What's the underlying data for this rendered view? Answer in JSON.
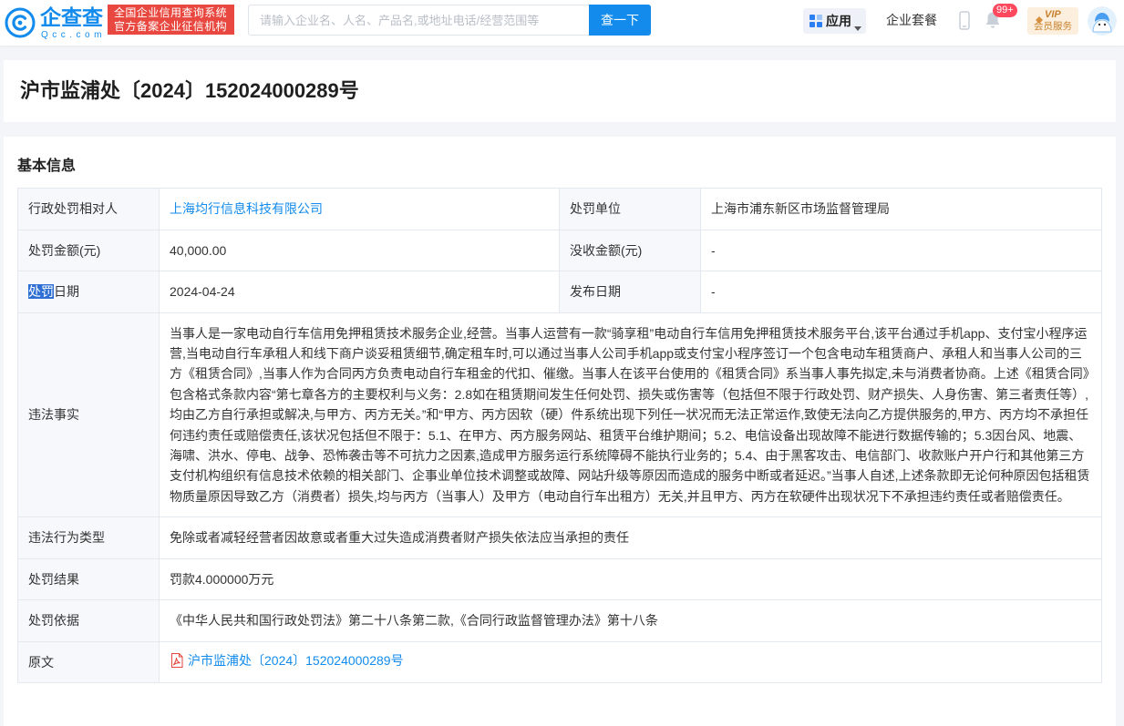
{
  "colors": {
    "brand": "#128bed",
    "link": "#128bed",
    "slogan_bg": "#e8483f",
    "badge": "#fd485e",
    "vip_text": "#c9822f",
    "vip_bg": "#fcefdd",
    "selection": "#2f6fd4",
    "page_bg": "#f3f5f8",
    "label_bg": "#f6f8fb",
    "border": "#e4e8ef"
  },
  "header": {
    "logo": {
      "name": "企查查",
      "domain": "Qcc.com",
      "icon": "qcc-logo-icon"
    },
    "slogan": [
      "全国企业信用查询系统",
      "官方备案企业征信机构"
    ],
    "search": {
      "placeholder": "请输入企业名、人名、产品名,或地址电话/经营范围等",
      "value": "",
      "button": "查一下"
    },
    "apps": {
      "label": "应用",
      "icon": "grid-icon"
    },
    "package": "企业套餐",
    "phone_icon": "mobile-phone-icon",
    "notifications": {
      "icon": "bell-icon",
      "badge": "99+"
    },
    "vip": {
      "title": "VIP",
      "subtitle": "会员服务"
    },
    "avatar_icon": "user-avatar"
  },
  "document": {
    "title": "沪市监浦处〔2024〕152024000289号"
  },
  "section": {
    "title": "基本信息"
  },
  "info": {
    "party": {
      "label": "行政处罚相对人",
      "value": "上海均行信息科技有限公司"
    },
    "authority": {
      "label": "处罚单位",
      "value": "上海市浦东新区市场监督管理局"
    },
    "fine_amount": {
      "label": "处罚金额(元)",
      "value": "40,000.00"
    },
    "confiscated_amount": {
      "label": "没收金额(元)",
      "value": "-"
    },
    "penalty_date": {
      "label_selected": "处罚",
      "label_rest": "日期",
      "value": "2024-04-24"
    },
    "publish_date": {
      "label": "发布日期",
      "value": "-"
    },
    "violation_facts": {
      "label": "违法事实",
      "value": "当事人是一家电动自行车信用免押租赁技术服务企业,经营。当事人运营有一款“骑享租”电动自行车信用免押租赁技术服务平台,该平台通过手机app、支付宝小程序运营,当电动自行车承租人和线下商户谈妥租赁细节,确定租车时,可以通过当事人公司手机app或支付宝小程序签订一个包含电动车租赁商户、承租人和当事人公司的三方《租赁合同》,当事人作为合同丙方负责电动自行车租金的代扣、催缴。当事人在该平台使用的《租赁合同》系当事人事先拟定,未与消费者协商。上述《租赁合同》包含格式条款内容“第七章各方的主要权利与义务：2.8如在租赁期间发生任何处罚、损失或伤害等（包括但不限于行政处罚、财产损失、人身伤害、第三者责任等）,均由乙方自行承担或解决,与甲方、丙方无关。”和“甲方、丙方因软（硬）件系统出现下列任一状况而无法正常运作,致使无法向乙方提供服务的,甲方、丙方均不承担任何违约责任或赔偿责任,该状况包括但不限于：5.1、在甲方、丙方服务网站、租赁平台维护期间；5.2、电信设备出现故障不能进行数据传输的；5.3因台风、地震、海啸、洪水、停电、战争、恐怖袭击等不可抗力之因素,造成甲方服务运行系统障碍不能执行业务的；5.4、由于黑客攻击、电信部门、收款账户开户行和其他第三方支付机构组织有信息技术依赖的相关部门、企事业单位技术调整或故障、网站升级等原因而造成的服务中断或者延迟。”当事人自述,上述条款即无论何种原因包括租赁物质量原因导致乙方（消费者）损失,均与丙方（当事人）及甲方（电动自行车出租方）无关,并且甲方、丙方在软硬件出现状况下不承担违约责任或者赔偿责任。"
    },
    "violation_type": {
      "label": "违法行为类型",
      "value": "免除或者减轻经营者因故意或者重大过失造成消费者财产损失依法应当承担的责任"
    },
    "penalty_result": {
      "label": "处罚结果",
      "value": "罚款4.000000万元"
    },
    "penalty_basis": {
      "label": "处罚依据",
      "value": "《中华人民共和国行政处罚法》第二十八条第二款,《合同行政监督管理办法》第十八条"
    },
    "original": {
      "label": "原文",
      "value": "沪市监浦处〔2024〕152024000289号",
      "icon": "pdf-icon"
    }
  }
}
